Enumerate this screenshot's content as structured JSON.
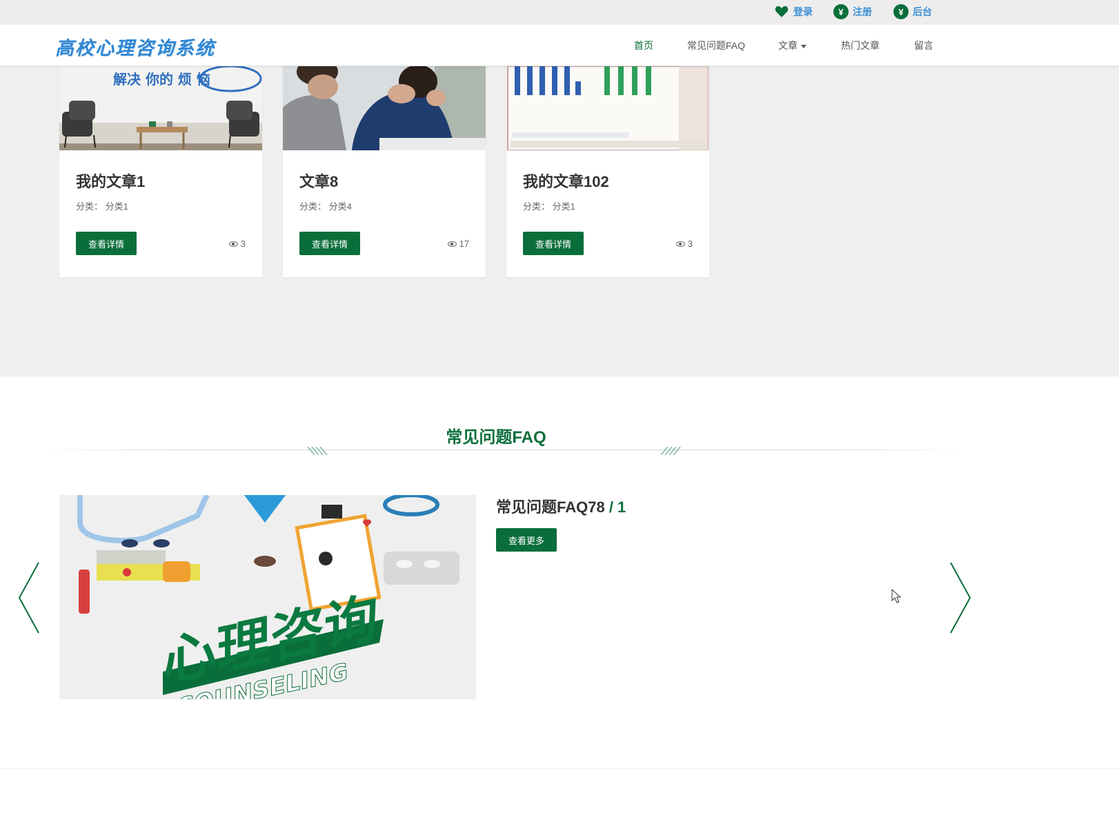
{
  "topbar": {
    "login_label": "登录",
    "register_label": "注册",
    "admin_label": "后台",
    "icon_glyph": "¥"
  },
  "navbar": {
    "logo_text": "高校心理咨询系统",
    "items": [
      {
        "label": "首页",
        "active": true
      },
      {
        "label": "常见问题FAQ"
      },
      {
        "label": "文章"
      },
      {
        "label": "热门文章"
      },
      {
        "label": "留言"
      }
    ]
  },
  "articles": [
    {
      "title": "我的文章1",
      "category": "分类：  分类1",
      "button": "查看详情",
      "views": "3",
      "image_text": "解决 你的 烦 恼"
    },
    {
      "title": "文章8",
      "category": "分类：  分类4",
      "button": "查看详情",
      "views": "17"
    },
    {
      "title": "我的文章102",
      "category": "分类：  分类1",
      "button": "查看详情",
      "views": "3"
    }
  ],
  "faq": {
    "section_title": "常见问题FAQ",
    "item_title": "常见问题FAQ78",
    "item_index": " / 1",
    "more_button": "查看更多",
    "image_text_cn": "心理咨询",
    "image_text_en": "COUNSELING"
  },
  "colors": {
    "brand_green": "#0a6e3a",
    "link_blue": "#3a8fd6",
    "section_gray": "#efefef"
  }
}
